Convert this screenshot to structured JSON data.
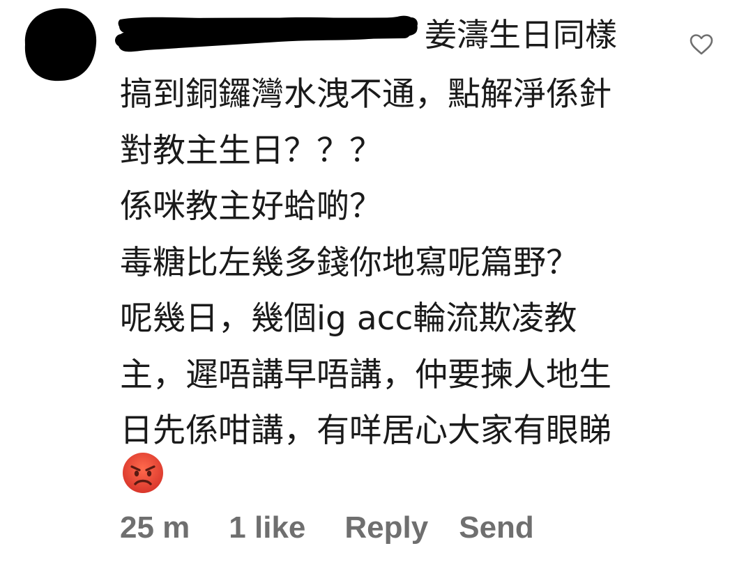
{
  "comment": {
    "author_suffix": "姜濤生日同樣",
    "lines": [
      "搞到銅鑼灣水洩不通，點解淨係針",
      "對教主生日？？？",
      "係咪教主好蛤啲？",
      "毒糖比左幾多錢你地寫呢篇野？",
      "呢幾日，幾個ig acc輪流欺凌教",
      "主，遲唔講早唔講，仲要揀人地生",
      "日先係咁講，有咩居心大家有眼睇"
    ],
    "emoji": "angry-face",
    "actions": {
      "time": "25 m",
      "likes": "1 like",
      "reply": "Reply",
      "send": "Send"
    }
  },
  "colors": {
    "text": "#1a1a1a",
    "meta_text": "#6f6f6f",
    "redaction": "#000000",
    "emoji_face": "#e8453c"
  },
  "icons": [
    "heart-outline-icon",
    "angry-face-emoji"
  ]
}
